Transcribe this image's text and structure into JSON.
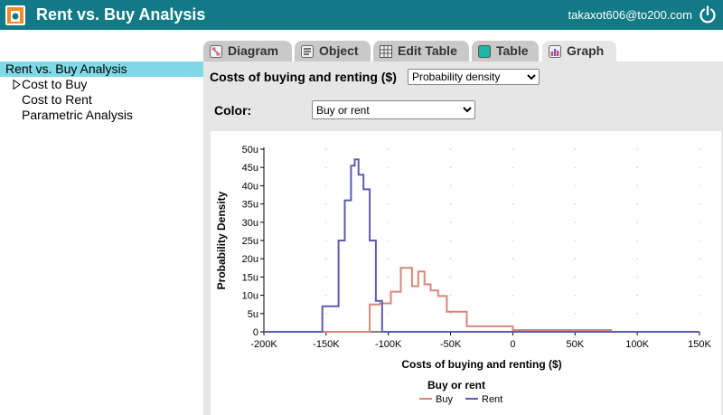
{
  "app": {
    "title": "Rent vs. Buy Analysis",
    "user_email": "takaxot606@to200.com",
    "brand_color": "#117a86"
  },
  "sidebar": {
    "root": "Rent vs. Buy Analysis",
    "items": [
      {
        "label": "Cost to Buy",
        "expandable": true
      },
      {
        "label": "Cost to Rent"
      },
      {
        "label": "Parametric Analysis"
      }
    ]
  },
  "tabs": [
    {
      "label": "Diagram",
      "icon": "diagram-icon"
    },
    {
      "label": "Object",
      "icon": "object-icon"
    },
    {
      "label": "Edit Table",
      "icon": "edit-table-icon"
    },
    {
      "label": "Table",
      "icon": "table-icon"
    },
    {
      "label": "Graph",
      "icon": "graph-icon",
      "active": true
    }
  ],
  "main": {
    "variable_label": "Costs of buying and renting ($)",
    "view_select": "Probability density",
    "color_label": "Color:",
    "color_select": "Buy or rent"
  },
  "chart_data": {
    "type": "line",
    "style": "step",
    "xlabel": "Costs of buying and renting ($)",
    "ylabel": "Probability Density",
    "xlim": [
      -200000,
      150000
    ],
    "ylim": [
      0,
      5e-05
    ],
    "x_ticks": [
      {
        "v": -200000,
        "label": "-200K"
      },
      {
        "v": -150000,
        "label": "-150K"
      },
      {
        "v": -100000,
        "label": "-100K"
      },
      {
        "v": -50000,
        "label": "-50K"
      },
      {
        "v": 0,
        "label": "0"
      },
      {
        "v": 50000,
        "label": "50K"
      },
      {
        "v": 100000,
        "label": "100K"
      },
      {
        "v": 150000,
        "label": "150K"
      }
    ],
    "y_ticks": [
      {
        "v": 0,
        "label": "0"
      },
      {
        "v": 5e-06,
        "label": "5u"
      },
      {
        "v": 1e-05,
        "label": "10u"
      },
      {
        "v": 1.5e-05,
        "label": "15u"
      },
      {
        "v": 2e-05,
        "label": "20u"
      },
      {
        "v": 2.5e-05,
        "label": "25u"
      },
      {
        "v": 3e-05,
        "label": "30u"
      },
      {
        "v": 3.5e-05,
        "label": "35u"
      },
      {
        "v": 4e-05,
        "label": "40u"
      },
      {
        "v": 4.5e-05,
        "label": "45u"
      },
      {
        "v": 5e-05,
        "label": "50u"
      }
    ],
    "grid": "dotted",
    "legend": {
      "title": "Buy or rent",
      "position": "bottom"
    },
    "series": [
      {
        "name": "Buy",
        "color": "#d9867a",
        "x": [
          -200000,
          -115000,
          -115000,
          -107000,
          -107000,
          -98000,
          -98000,
          -90000,
          -90000,
          -81000,
          -81000,
          -76000,
          -76000,
          -71000,
          -71000,
          -66000,
          -66000,
          -60000,
          -60000,
          -53000,
          -53000,
          -37000,
          -37000,
          0,
          0,
          79000,
          79000,
          130000
        ],
        "y": [
          0,
          0,
          7.5e-06,
          7.5e-06,
          7.8e-06,
          7.8e-06,
          1.1e-05,
          1.1e-05,
          1.75e-05,
          1.75e-05,
          1.25e-05,
          1.25e-05,
          1.65e-05,
          1.65e-05,
          1.3e-05,
          1.3e-05,
          1.13e-05,
          1.13e-05,
          9.8e-06,
          9.8e-06,
          5.5e-06,
          5.5e-06,
          1.5e-06,
          1.5e-06,
          5e-07,
          5e-07,
          0,
          0
        ]
      },
      {
        "name": "Rent",
        "color": "#5d5caf",
        "x": [
          -200000,
          -153000,
          -153000,
          -140000,
          -140000,
          -135000,
          -135000,
          -130000,
          -130000,
          -127000,
          -127000,
          -124000,
          -124000,
          -120000,
          -120000,
          -115000,
          -115000,
          -110000,
          -110000,
          -105000,
          -105000,
          150000
        ],
        "y": [
          0,
          0,
          7e-06,
          7e-06,
          2.5e-05,
          2.5e-05,
          3.6e-05,
          3.6e-05,
          4.55e-05,
          4.55e-05,
          4.72e-05,
          4.72e-05,
          4.3e-05,
          4.3e-05,
          3.9e-05,
          3.9e-05,
          2.5e-05,
          2.5e-05,
          8.5e-06,
          8.5e-06,
          0,
          0
        ]
      }
    ]
  }
}
